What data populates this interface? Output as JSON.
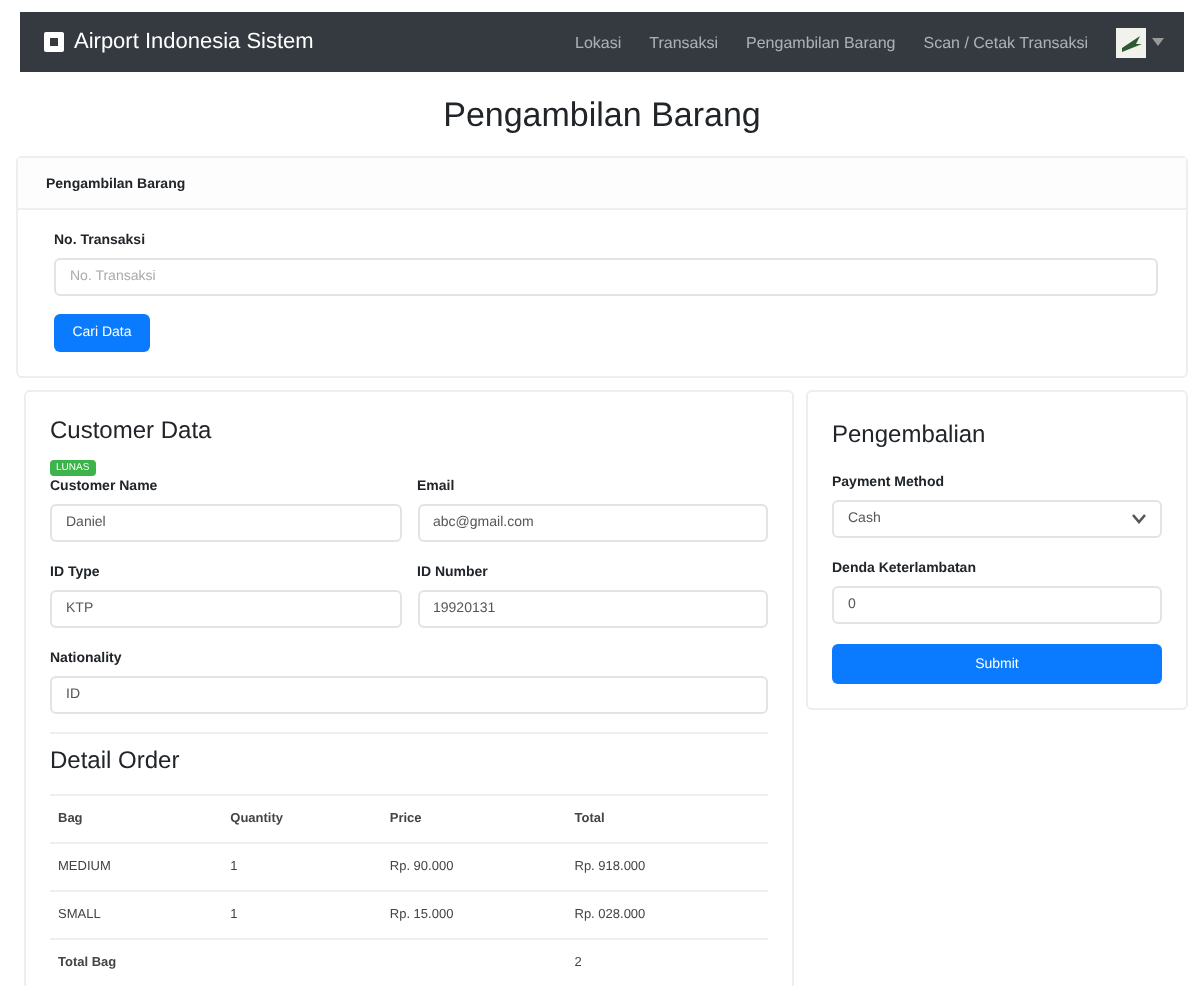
{
  "navbar": {
    "brand": "Airport Indonesia Sistem",
    "links": [
      {
        "label": "Lokasi"
      },
      {
        "label": "Transaksi"
      },
      {
        "label": "Pengambilan Barang"
      },
      {
        "label": "Scan / Cetak Transaksi"
      }
    ]
  },
  "page_title": "Pengambilan Barang",
  "search_card": {
    "header": "Pengambilan Barang",
    "label": "No. Transaksi",
    "placeholder": "No. Transaksi",
    "button": "Cari Data"
  },
  "customer": {
    "title": "Customer Data",
    "badge": "LUNAS",
    "fields": [
      {
        "label": "Customer Name",
        "value": "Daniel"
      },
      {
        "label": "Email",
        "value": "abc@gmail.com"
      },
      {
        "label": "ID Type",
        "value": "KTP"
      },
      {
        "label": "ID Number",
        "value": "19920131"
      },
      {
        "label": "Nationality",
        "value": "ID"
      }
    ]
  },
  "detail_order": {
    "title": "Detail Order",
    "columns": [
      "Bag",
      "Quantity",
      "Price",
      "Total"
    ],
    "rows": [
      [
        "MEDIUM",
        "1",
        "Rp. 90.000",
        "Rp. 918.000"
      ],
      [
        "SMALL",
        "1",
        "Rp. 15.000",
        "Rp. 028.000"
      ]
    ],
    "footer": {
      "label": "Total Bag",
      "value": "2"
    }
  },
  "pengembalian": {
    "title": "Pengembalian",
    "payment_label": "Payment Method",
    "payment_value": "Cash",
    "denda_label": "Denda Keterlambatan",
    "denda_value": "0",
    "button": "Submit"
  }
}
